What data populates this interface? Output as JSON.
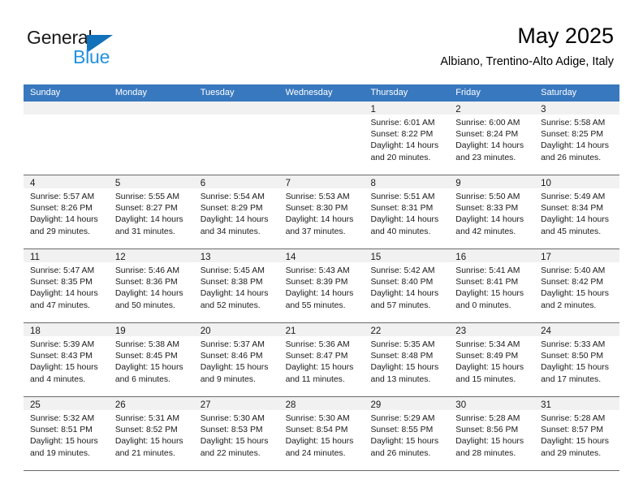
{
  "brand": {
    "name_top": "General",
    "name_bottom": "Blue",
    "accent_color": "#2191e0",
    "triangle_color": "#1271bb"
  },
  "header": {
    "title": "May 2025",
    "subtitle": "Albiano, Trentino-Alto Adige, Italy"
  },
  "calendar": {
    "header_bg": "#3878be",
    "weekday_headers": [
      "Sunday",
      "Monday",
      "Tuesday",
      "Wednesday",
      "Thursday",
      "Friday",
      "Saturday"
    ],
    "weeks": [
      [
        {
          "day": "",
          "lines": []
        },
        {
          "day": "",
          "lines": []
        },
        {
          "day": "",
          "lines": []
        },
        {
          "day": "",
          "lines": []
        },
        {
          "day": "1",
          "lines": [
            "Sunrise: 6:01 AM",
            "Sunset: 8:22 PM",
            "Daylight: 14 hours",
            "and 20 minutes."
          ]
        },
        {
          "day": "2",
          "lines": [
            "Sunrise: 6:00 AM",
            "Sunset: 8:24 PM",
            "Daylight: 14 hours",
            "and 23 minutes."
          ]
        },
        {
          "day": "3",
          "lines": [
            "Sunrise: 5:58 AM",
            "Sunset: 8:25 PM",
            "Daylight: 14 hours",
            "and 26 minutes."
          ]
        }
      ],
      [
        {
          "day": "4",
          "lines": [
            "Sunrise: 5:57 AM",
            "Sunset: 8:26 PM",
            "Daylight: 14 hours",
            "and 29 minutes."
          ]
        },
        {
          "day": "5",
          "lines": [
            "Sunrise: 5:55 AM",
            "Sunset: 8:27 PM",
            "Daylight: 14 hours",
            "and 31 minutes."
          ]
        },
        {
          "day": "6",
          "lines": [
            "Sunrise: 5:54 AM",
            "Sunset: 8:29 PM",
            "Daylight: 14 hours",
            "and 34 minutes."
          ]
        },
        {
          "day": "7",
          "lines": [
            "Sunrise: 5:53 AM",
            "Sunset: 8:30 PM",
            "Daylight: 14 hours",
            "and 37 minutes."
          ]
        },
        {
          "day": "8",
          "lines": [
            "Sunrise: 5:51 AM",
            "Sunset: 8:31 PM",
            "Daylight: 14 hours",
            "and 40 minutes."
          ]
        },
        {
          "day": "9",
          "lines": [
            "Sunrise: 5:50 AM",
            "Sunset: 8:33 PM",
            "Daylight: 14 hours",
            "and 42 minutes."
          ]
        },
        {
          "day": "10",
          "lines": [
            "Sunrise: 5:49 AM",
            "Sunset: 8:34 PM",
            "Daylight: 14 hours",
            "and 45 minutes."
          ]
        }
      ],
      [
        {
          "day": "11",
          "lines": [
            "Sunrise: 5:47 AM",
            "Sunset: 8:35 PM",
            "Daylight: 14 hours",
            "and 47 minutes."
          ]
        },
        {
          "day": "12",
          "lines": [
            "Sunrise: 5:46 AM",
            "Sunset: 8:36 PM",
            "Daylight: 14 hours",
            "and 50 minutes."
          ]
        },
        {
          "day": "13",
          "lines": [
            "Sunrise: 5:45 AM",
            "Sunset: 8:38 PM",
            "Daylight: 14 hours",
            "and 52 minutes."
          ]
        },
        {
          "day": "14",
          "lines": [
            "Sunrise: 5:43 AM",
            "Sunset: 8:39 PM",
            "Daylight: 14 hours",
            "and 55 minutes."
          ]
        },
        {
          "day": "15",
          "lines": [
            "Sunrise: 5:42 AM",
            "Sunset: 8:40 PM",
            "Daylight: 14 hours",
            "and 57 minutes."
          ]
        },
        {
          "day": "16",
          "lines": [
            "Sunrise: 5:41 AM",
            "Sunset: 8:41 PM",
            "Daylight: 15 hours",
            "and 0 minutes."
          ]
        },
        {
          "day": "17",
          "lines": [
            "Sunrise: 5:40 AM",
            "Sunset: 8:42 PM",
            "Daylight: 15 hours",
            "and 2 minutes."
          ]
        }
      ],
      [
        {
          "day": "18",
          "lines": [
            "Sunrise: 5:39 AM",
            "Sunset: 8:43 PM",
            "Daylight: 15 hours",
            "and 4 minutes."
          ]
        },
        {
          "day": "19",
          "lines": [
            "Sunrise: 5:38 AM",
            "Sunset: 8:45 PM",
            "Daylight: 15 hours",
            "and 6 minutes."
          ]
        },
        {
          "day": "20",
          "lines": [
            "Sunrise: 5:37 AM",
            "Sunset: 8:46 PM",
            "Daylight: 15 hours",
            "and 9 minutes."
          ]
        },
        {
          "day": "21",
          "lines": [
            "Sunrise: 5:36 AM",
            "Sunset: 8:47 PM",
            "Daylight: 15 hours",
            "and 11 minutes."
          ]
        },
        {
          "day": "22",
          "lines": [
            "Sunrise: 5:35 AM",
            "Sunset: 8:48 PM",
            "Daylight: 15 hours",
            "and 13 minutes."
          ]
        },
        {
          "day": "23",
          "lines": [
            "Sunrise: 5:34 AM",
            "Sunset: 8:49 PM",
            "Daylight: 15 hours",
            "and 15 minutes."
          ]
        },
        {
          "day": "24",
          "lines": [
            "Sunrise: 5:33 AM",
            "Sunset: 8:50 PM",
            "Daylight: 15 hours",
            "and 17 minutes."
          ]
        }
      ],
      [
        {
          "day": "25",
          "lines": [
            "Sunrise: 5:32 AM",
            "Sunset: 8:51 PM",
            "Daylight: 15 hours",
            "and 19 minutes."
          ]
        },
        {
          "day": "26",
          "lines": [
            "Sunrise: 5:31 AM",
            "Sunset: 8:52 PM",
            "Daylight: 15 hours",
            "and 21 minutes."
          ]
        },
        {
          "day": "27",
          "lines": [
            "Sunrise: 5:30 AM",
            "Sunset: 8:53 PM",
            "Daylight: 15 hours",
            "and 22 minutes."
          ]
        },
        {
          "day": "28",
          "lines": [
            "Sunrise: 5:30 AM",
            "Sunset: 8:54 PM",
            "Daylight: 15 hours",
            "and 24 minutes."
          ]
        },
        {
          "day": "29",
          "lines": [
            "Sunrise: 5:29 AM",
            "Sunset: 8:55 PM",
            "Daylight: 15 hours",
            "and 26 minutes."
          ]
        },
        {
          "day": "30",
          "lines": [
            "Sunrise: 5:28 AM",
            "Sunset: 8:56 PM",
            "Daylight: 15 hours",
            "and 28 minutes."
          ]
        },
        {
          "day": "31",
          "lines": [
            "Sunrise: 5:28 AM",
            "Sunset: 8:57 PM",
            "Daylight: 15 hours",
            "and 29 minutes."
          ]
        }
      ]
    ]
  }
}
